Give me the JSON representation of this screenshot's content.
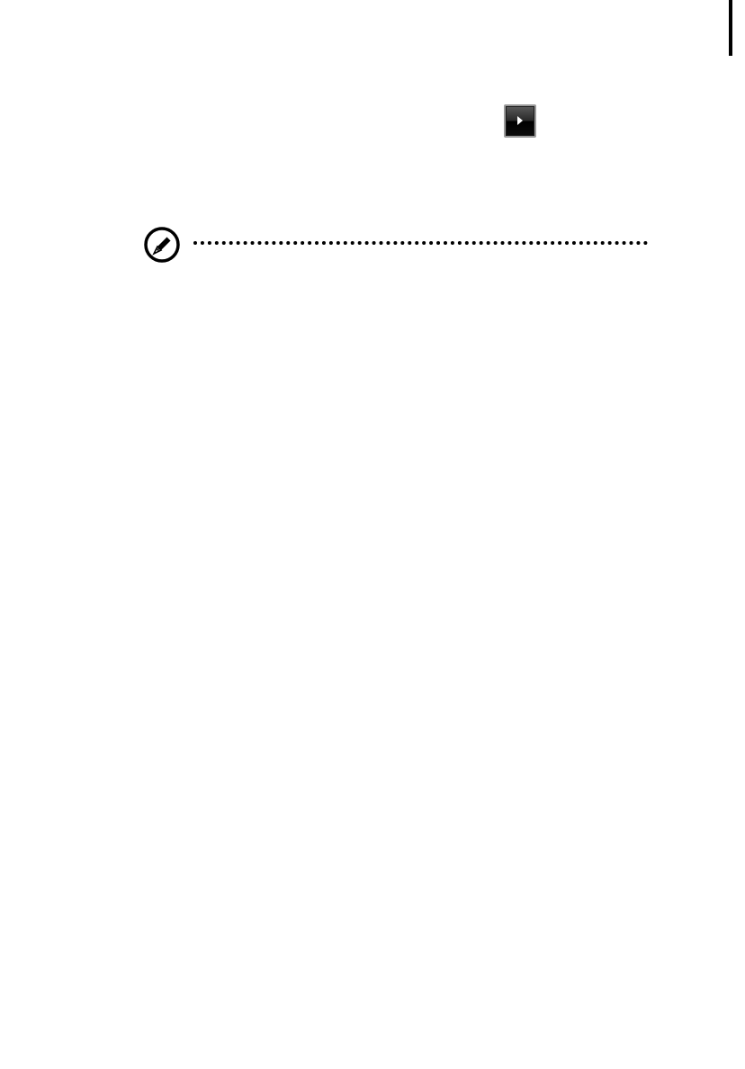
{
  "page": {
    "background_color": "#ffffff",
    "ink_color": "#000000"
  },
  "media_control": {
    "icon": "play-icon",
    "button_style": "dark-glossy"
  },
  "note": {
    "icon": "note-pen-icon",
    "divider_style": "dotted"
  }
}
